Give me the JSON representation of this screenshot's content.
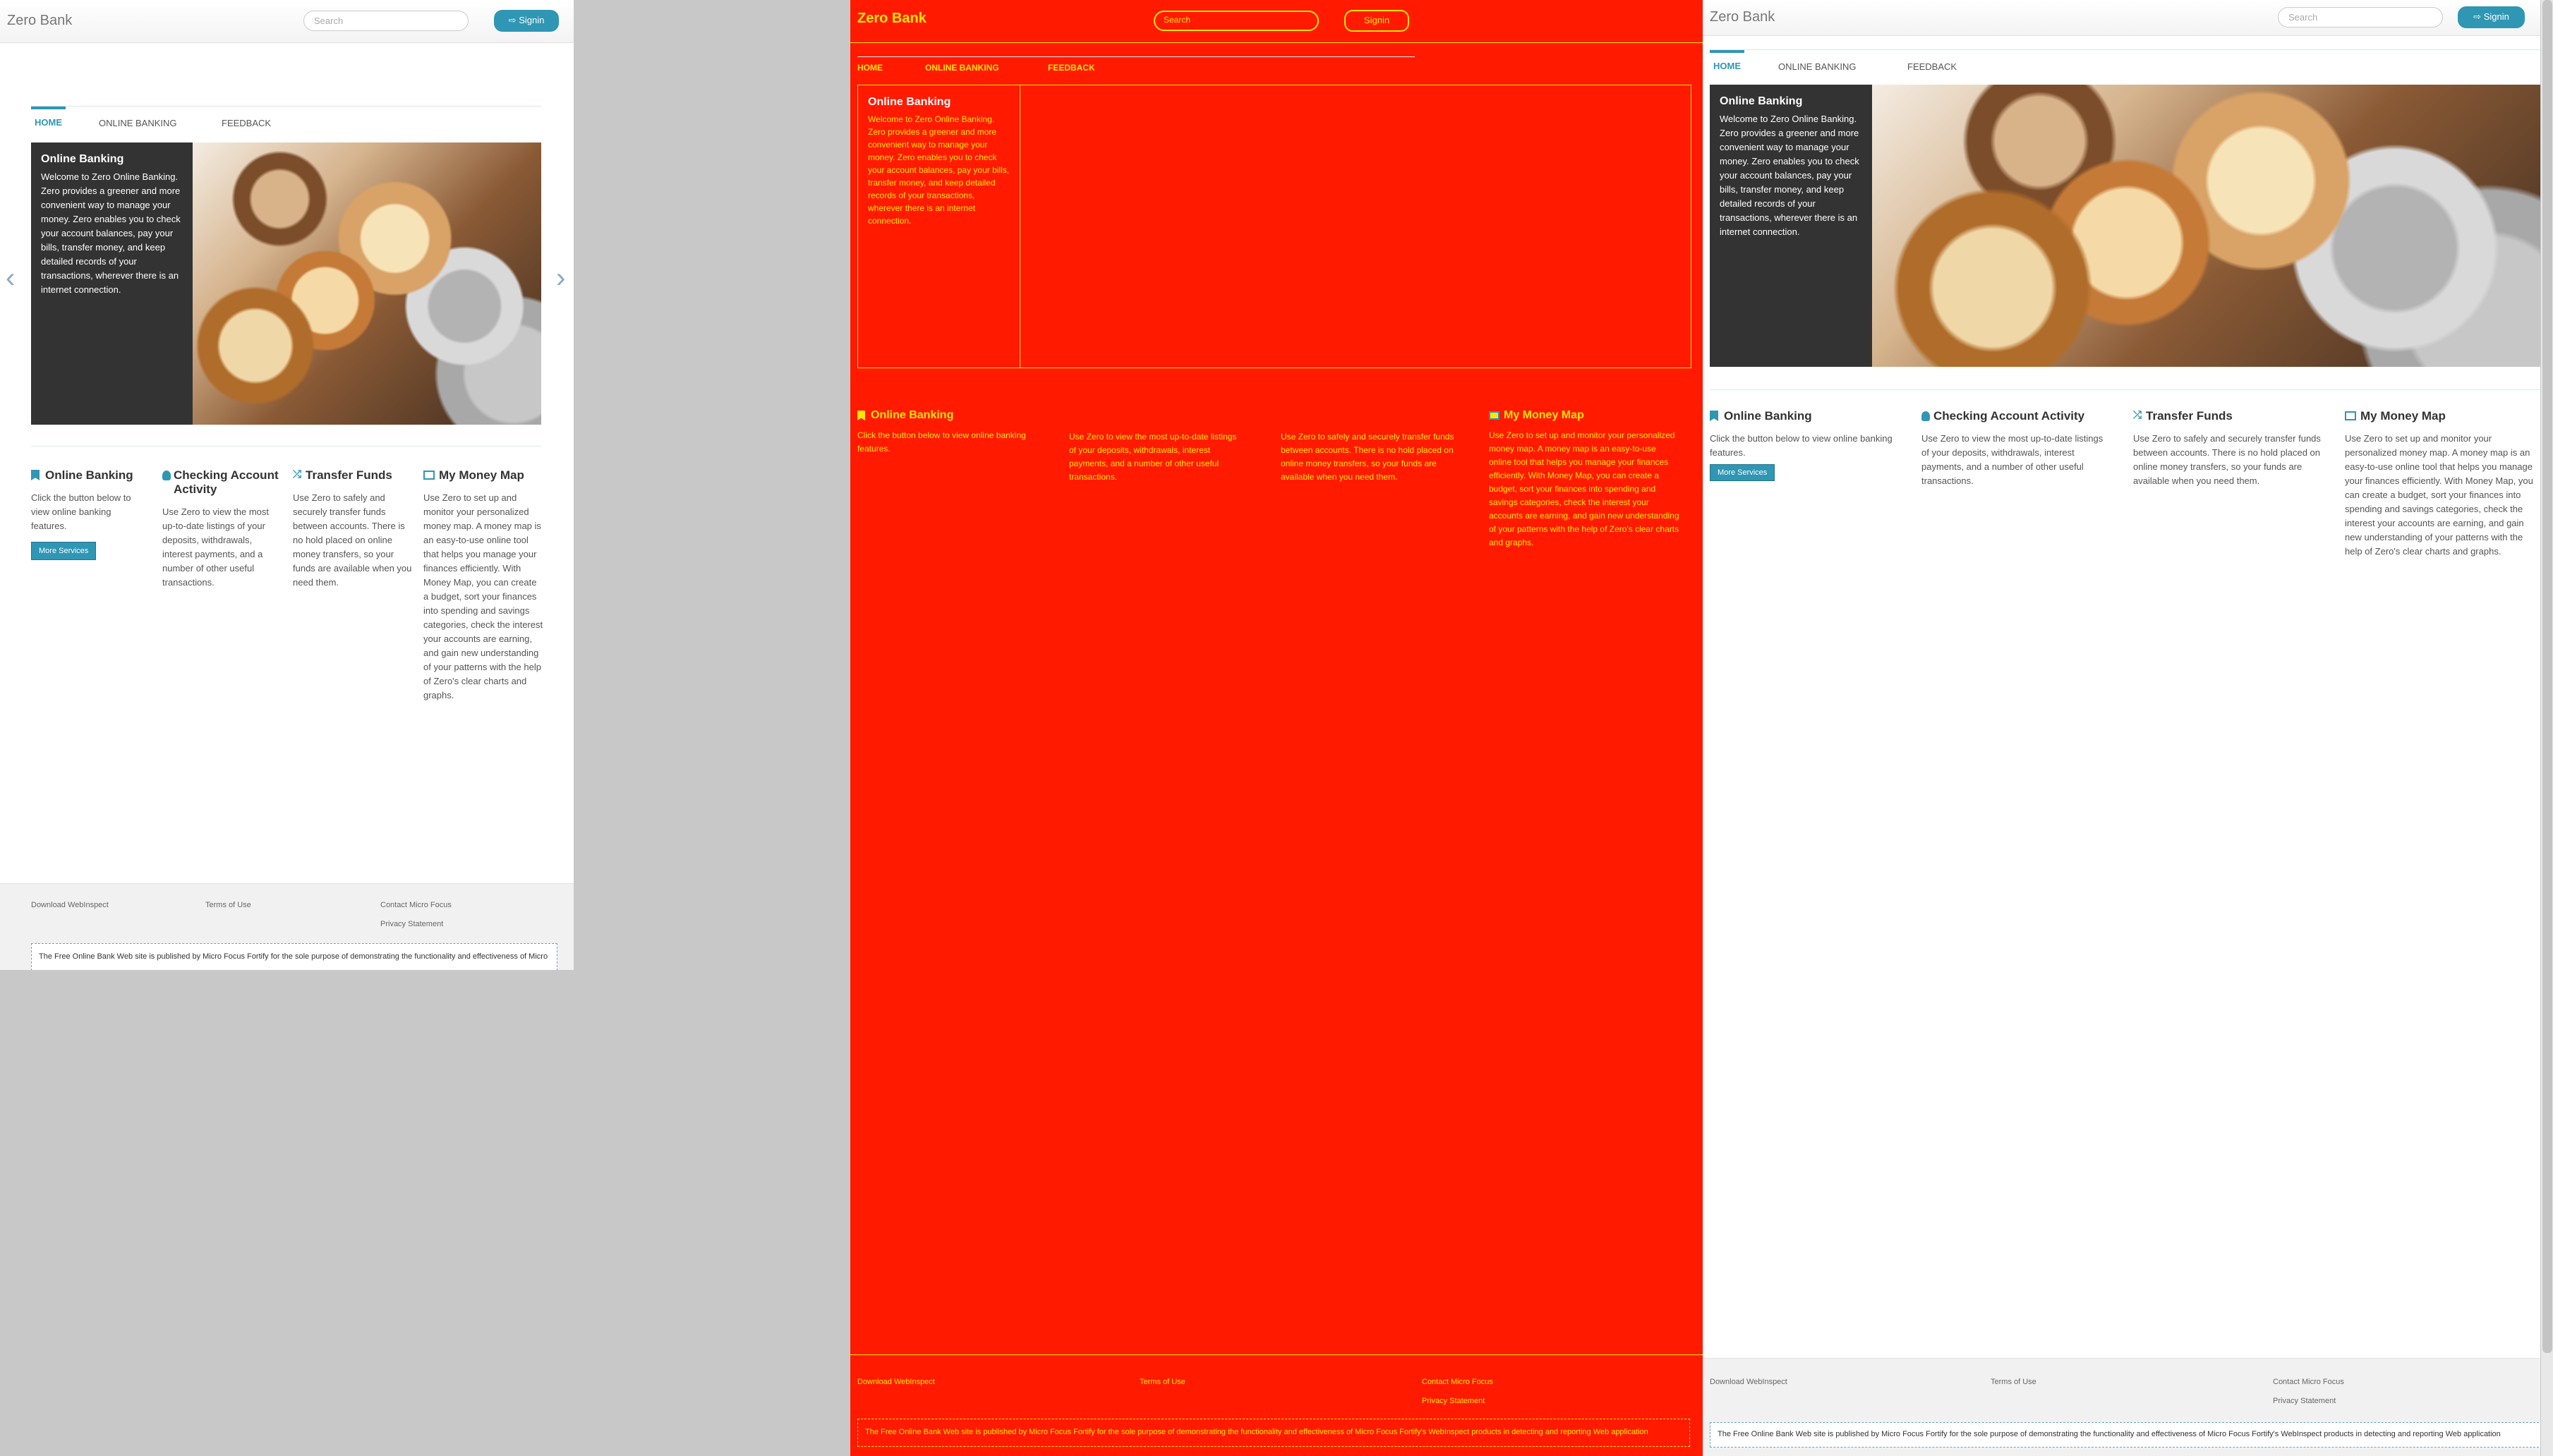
{
  "brand": "Zero Bank",
  "search_placeholder": "Search",
  "signin_label": "Signin",
  "tabs": [
    "HOME",
    "ONLINE BANKING",
    "FEEDBACK"
  ],
  "carousel": {
    "title": "Online Banking",
    "body": "Welcome to Zero Online Banking. Zero provides a greener and more convenient way to manage your money. Zero enables you to check your account balances, pay your bills, transfer money, and keep detailed records of your transactions, wherever there is an internet connection.",
    "prev_glyph": "‹",
    "next_glyph": "›"
  },
  "features": [
    {
      "title": "Online Banking",
      "icon": "bookmark-icon",
      "text": "Click the button below to view online banking features.",
      "button": "More Services"
    },
    {
      "title": "Checking Account Activity",
      "icon": "user-icon",
      "text": "Use Zero to view the most up-to-date listings of your deposits, withdrawals, interest payments, and a number of other useful transactions."
    },
    {
      "title": "Transfer Funds",
      "icon": "shuffle-icon",
      "text": "Use Zero to safely and securely transfer funds between accounts. There is no hold placed on online money transfers, so your funds are available when you need them."
    },
    {
      "title": "My Money Map",
      "icon": "map-icon",
      "text": "Use Zero to set up and monitor your personalized money map. A money map is an easy-to-use online tool that helps you manage your finances efficiently. With Money Map, you can create a budget, sort your finances into spending and savings categories, check the interest your accounts are earning, and gain new understanding of your patterns with the help of Zero's clear charts and graphs."
    }
  ],
  "footer": {
    "download": "Download WebInspect",
    "terms": "Terms of Use",
    "contact": "Contact Micro Focus",
    "privacy": "Privacy Statement",
    "disclaimer_left": "The Free Online Bank Web site is published by Micro Focus Fortify for the sole purpose of demonstrating the functionality and effectiveness of Micro",
    "disclaimer_right": "The Free Online Bank Web site is published by Micro Focus Fortify for the sole purpose of demonstrating the functionality and effectiveness of Micro Focus Fortify's WebInspect products in detecting and reporting Web application"
  },
  "colors": {
    "accent": "#2f96b4",
    "diff_red": "#ff1a00",
    "diff_yellow": "#ffe600",
    "slide_panel": "#333333"
  }
}
